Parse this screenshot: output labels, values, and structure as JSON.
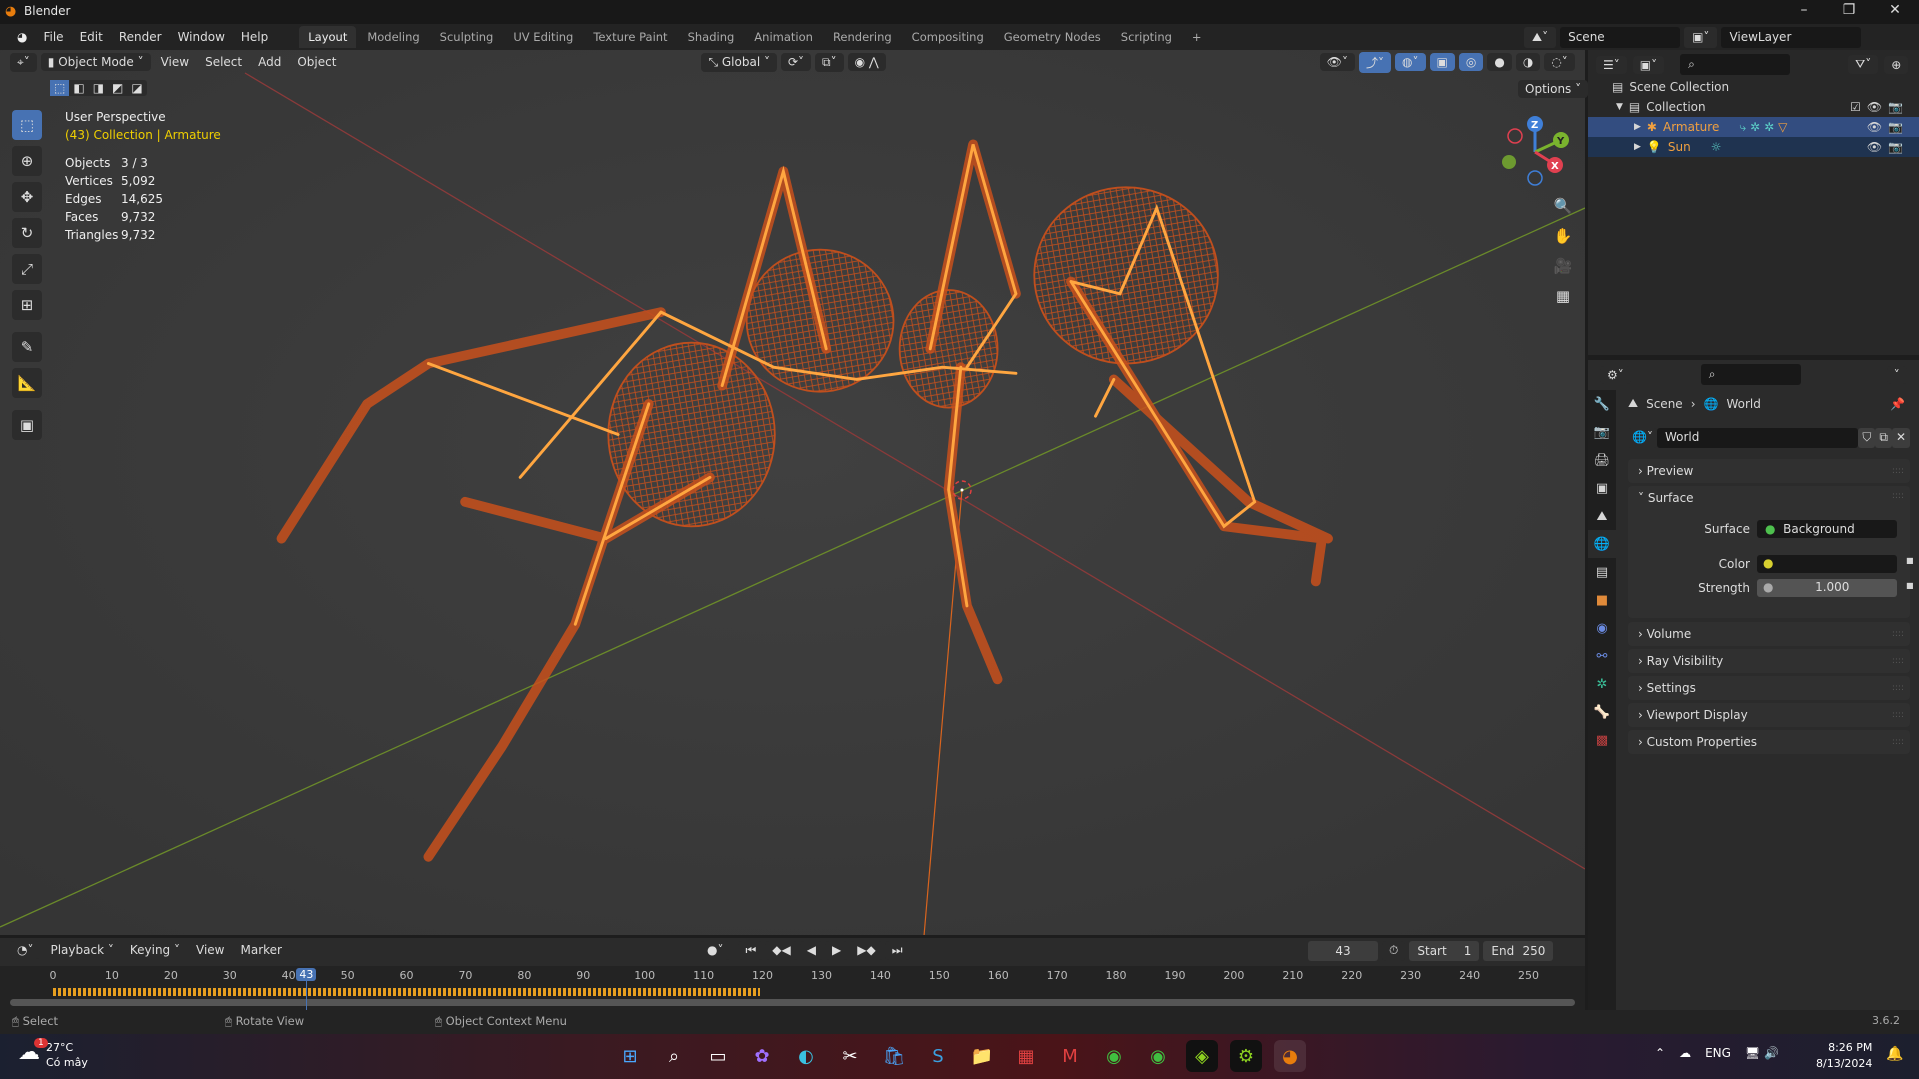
{
  "window": {
    "title": "Blender",
    "minimize": "–",
    "maximize": "❐",
    "close": "✕"
  },
  "menu": [
    "File",
    "Edit",
    "Render",
    "Window",
    "Help"
  ],
  "workspaces": [
    "Layout",
    "Modeling",
    "Sculpting",
    "UV Editing",
    "Texture Paint",
    "Shading",
    "Animation",
    "Rendering",
    "Compositing",
    "Geometry Nodes",
    "Scripting",
    "+"
  ],
  "scene": {
    "name": "Scene",
    "view_layer": "ViewLayer"
  },
  "viewport_header": {
    "mode": "Object Mode",
    "menus": [
      "View",
      "Select",
      "Add",
      "Object"
    ],
    "orientation": "Global",
    "options": "Options"
  },
  "overlay": {
    "view": "User Perspective",
    "context": "(43) Collection | Armature",
    "stats": [
      {
        "k": "Objects",
        "v": "3 / 3"
      },
      {
        "k": "Vertices",
        "v": "5,092"
      },
      {
        "k": "Edges",
        "v": "14,625"
      },
      {
        "k": "Faces",
        "v": "9,732"
      },
      {
        "k": "Triangles",
        "v": "9,732"
      }
    ]
  },
  "gizmo": {
    "z": "Z",
    "y": "Y",
    "x": "X"
  },
  "outliner": {
    "rows": [
      {
        "label": "Scene Collection"
      },
      {
        "label": "Collection"
      },
      {
        "label": "Armature"
      },
      {
        "label": "Sun"
      }
    ]
  },
  "properties": {
    "breadcrumb": [
      "Scene",
      "World"
    ],
    "world_name": "World",
    "panels": {
      "preview": "Preview",
      "surface": "Surface",
      "volume": "Volume",
      "ray": "Ray Visibility",
      "settings": "Settings",
      "viewport": "Viewport Display",
      "custom": "Custom Properties"
    },
    "surface_label": "Surface",
    "surface_value": "Background",
    "color_label": "Color",
    "strength_label": "Strength",
    "strength_value": "1.000"
  },
  "timeline": {
    "menus": [
      "Playback",
      "Keying",
      "View",
      "Marker"
    ],
    "current_frame": 43,
    "current_frame_text": "43",
    "start_label": "Start",
    "start": "1",
    "end_label": "End",
    "end": "250",
    "range": [
      0,
      250
    ],
    "tick_step": 10,
    "last_keyframe": 120
  },
  "status": {
    "select": "Select",
    "rotate": "Rotate View",
    "context": "Object Context Menu",
    "version": "3.6.2"
  },
  "taskbar": {
    "temp": "27°C",
    "weather": "Có mây",
    "lang": "ENG",
    "time": "8:26 PM",
    "date": "8/13/2024",
    "badge": "1"
  },
  "colors": {
    "accent": "#4772b3",
    "wire": "#c8501c",
    "bone": "#ffa640",
    "active_text": "#f0a040"
  }
}
